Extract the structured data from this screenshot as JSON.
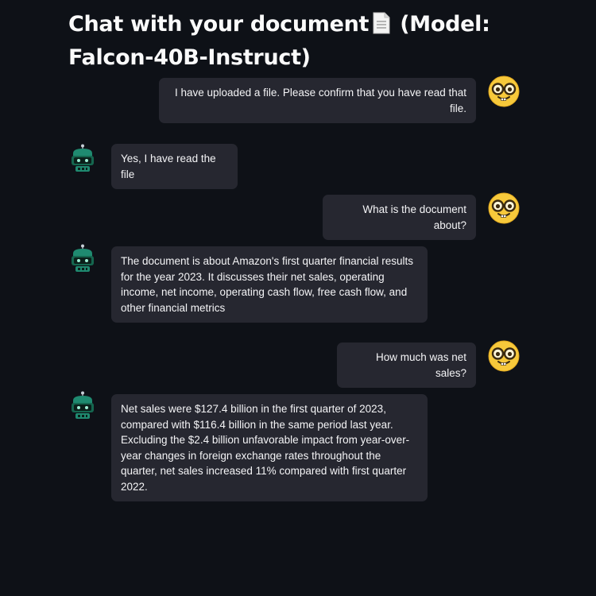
{
  "header": {
    "title_before_icon": "Chat with your document",
    "title_after_icon": " (Model: Falcon-40B-Instruct)",
    "doc_icon": "page-facing-up-icon"
  },
  "messages": [
    {
      "role": "user",
      "avatar": "nerd-face-icon",
      "text": "I have uploaded a file. Please confirm that you have read that file."
    },
    {
      "role": "assistant",
      "avatar": "robot-icon",
      "text": "Yes, I have read the file"
    },
    {
      "role": "user",
      "avatar": "nerd-face-icon",
      "text": "What is the document about?"
    },
    {
      "role": "assistant",
      "avatar": "robot-icon",
      "text": "The document is about Amazon's first quarter financial results for the year 2023. It discusses their net sales, operating income, net income, operating cash flow, free cash flow, and other financial metrics"
    },
    {
      "role": "user",
      "avatar": "nerd-face-icon",
      "text": "How much was net sales?"
    },
    {
      "role": "assistant",
      "avatar": "robot-icon",
      "text": "Net sales were $127.4 billion in the first quarter of 2023, compared with $116.4 billion in the same period last year. Excluding the $2.4 billion unfavorable impact from year-over-year changes in foreign exchange rates throughout the quarter, net sales increased 11% compared with first quarter 2022."
    }
  ],
  "colors": {
    "background": "#0e1117",
    "bubble": "#262730",
    "text": "#fafafa",
    "robot_accent": "#1f8a70"
  }
}
